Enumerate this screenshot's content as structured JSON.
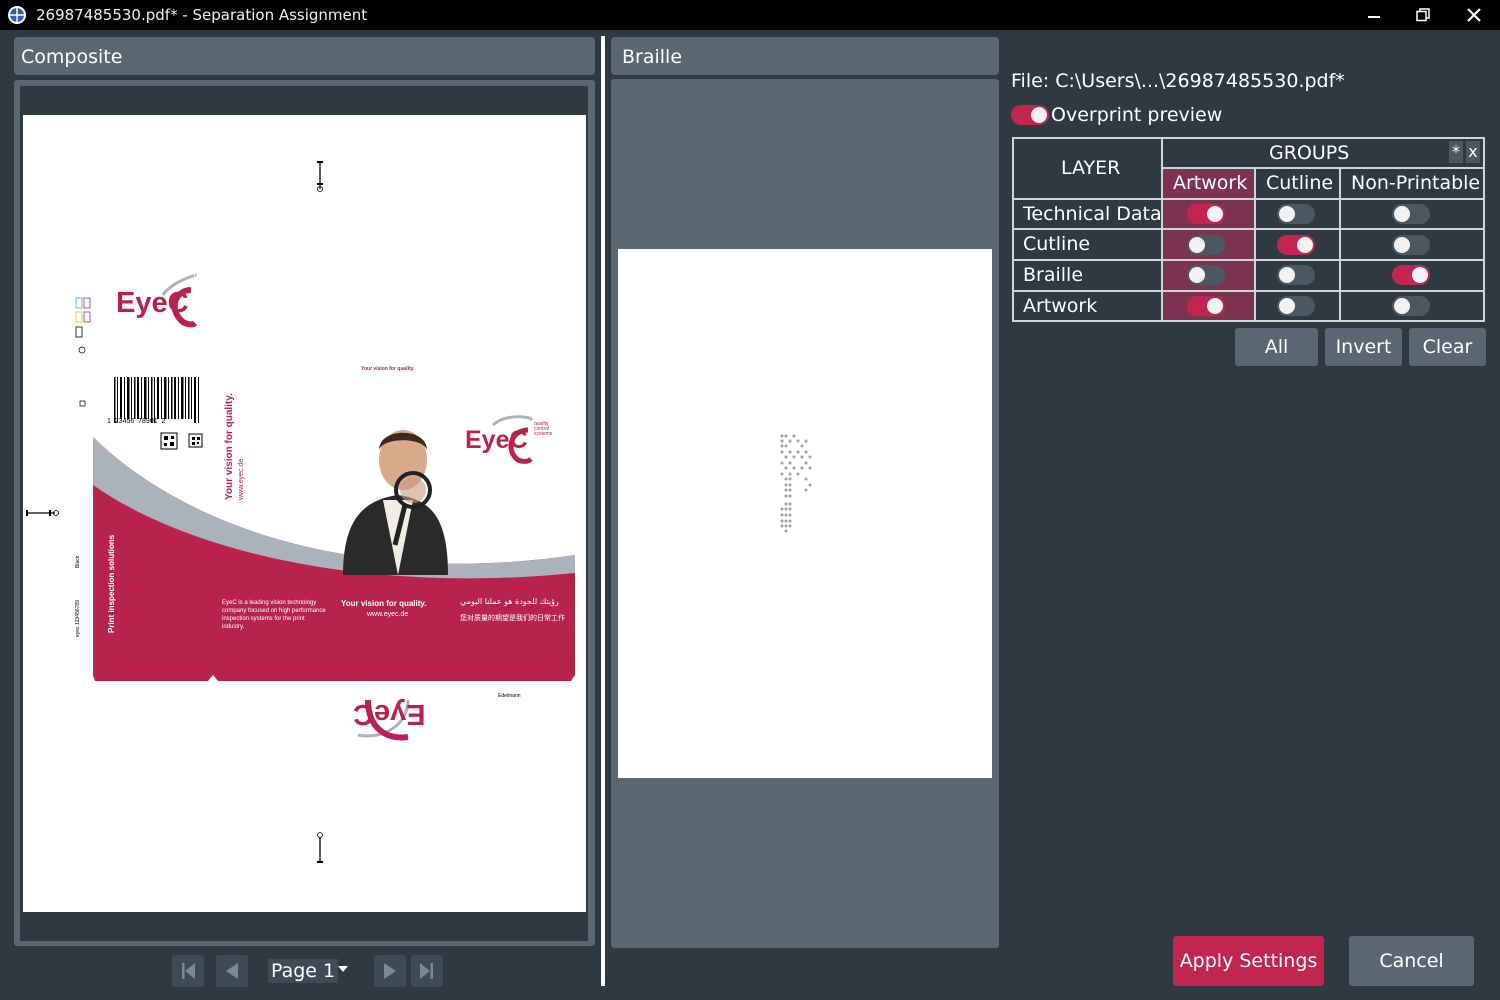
{
  "window": {
    "title": "26987485530.pdf* - Separation Assignment",
    "controls": {
      "minimize": "—",
      "restore": "❐",
      "close": "✕"
    }
  },
  "composite": {
    "header": "Composite",
    "artwork": {
      "logo_top": "EyeC",
      "tagline_small": "Your vision for quality.",
      "logo_main": "EyeC",
      "logo_sub": [
        "quality",
        "control",
        "systems"
      ],
      "vertical_tagline": "Your vision for quality.",
      "vertical_url": "www.eyec.de",
      "side_text": "Print inspection solutions",
      "barcode_digits": "1  23456  78901  2",
      "paragraph": "EyeC is a leading vision technology company focused on high performance inspection systems for the print industry.",
      "center_tagline": "Your vision for quality.",
      "center_url": "www.eyec.de",
      "arabic_text": "رؤيتك للجودة هو عملنا اليومي",
      "chinese_text": "您对质量的期望是我们的日常工作",
      "brand_small": "Edelmann",
      "logo_bottom": "EyeC",
      "side_code": "eyec 123456789",
      "side_label": "Black"
    }
  },
  "braille": {
    "header": "Braille"
  },
  "navigation": {
    "page_label": "Page 1"
  },
  "file": {
    "label": "File: C:\\Users\\...\\26987485530.pdf*"
  },
  "overprint": {
    "label": "Overprint preview",
    "enabled": true
  },
  "table": {
    "layer_header": "LAYER",
    "groups_header": "GROUPS",
    "star_button": "*",
    "x_button": "x",
    "columns": [
      "Artwork",
      "Cutline",
      "Non-Printable"
    ],
    "rows": [
      {
        "layer": "Technical Data",
        "values": [
          true,
          false,
          false
        ]
      },
      {
        "layer": "Cutline",
        "values": [
          false,
          true,
          false
        ]
      },
      {
        "layer": "Braille",
        "values": [
          false,
          false,
          true
        ]
      },
      {
        "layer": "Artwork",
        "values": [
          true,
          false,
          false
        ]
      }
    ]
  },
  "actions": {
    "all": "All",
    "invert": "Invert",
    "clear": "Clear"
  },
  "footer": {
    "apply": "Apply Settings",
    "cancel": "Cancel"
  },
  "colors": {
    "accent": "#c2254f",
    "background": "#2e3942",
    "panel": "#5a6671"
  }
}
